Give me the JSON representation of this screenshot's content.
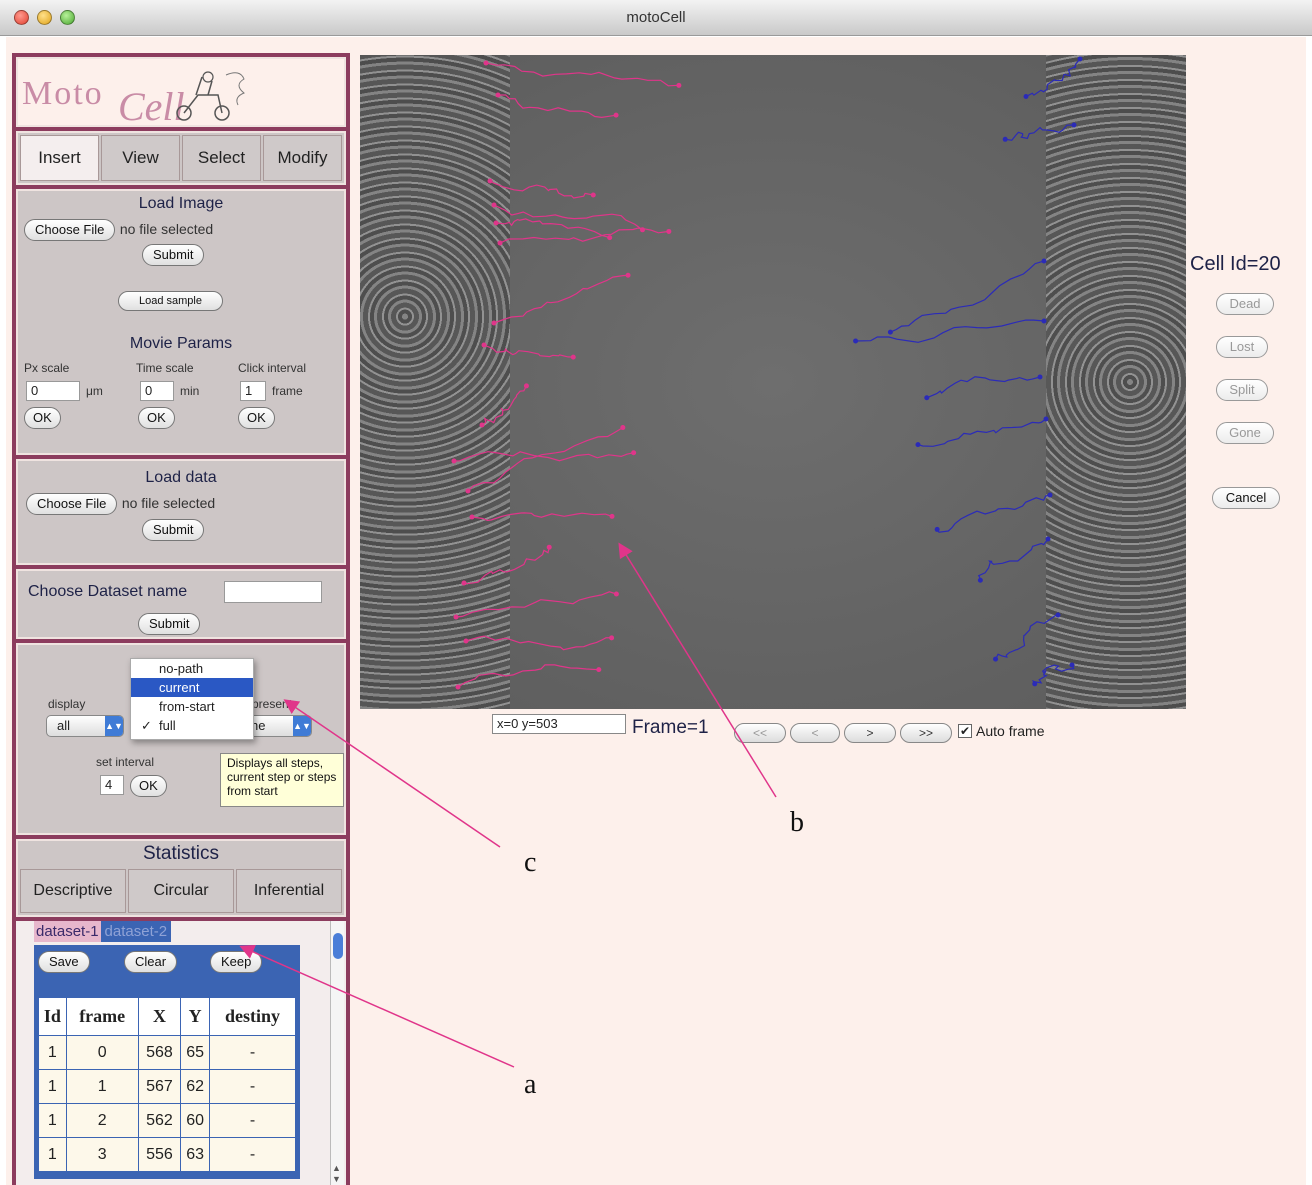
{
  "window": {
    "title": "motoCell"
  },
  "logo": {
    "text_a": "Moto",
    "text_b": "Cell"
  },
  "tabs": [
    "Insert",
    "View",
    "Select",
    "Modify"
  ],
  "load_image": {
    "title": "Load Image",
    "choose_file": "Choose File",
    "no_file": "no file selected",
    "submit": "Submit",
    "load_sample": "Load sample"
  },
  "movie_params": {
    "title": "Movie Params",
    "px_scale": {
      "label": "Px scale",
      "value": "0",
      "unit": "μm",
      "ok": "OK"
    },
    "time_scale": {
      "label": "Time scale",
      "value": "0",
      "unit": "min",
      "ok": "OK"
    },
    "click_interval": {
      "label": "Click interval",
      "value": "1",
      "unit": "frame",
      "ok": "OK"
    }
  },
  "load_data": {
    "title": "Load data",
    "choose_file": "Choose File",
    "no_file": "no file selected",
    "submit": "Submit"
  },
  "dataset_name": {
    "label": "Choose Dataset name",
    "value": "",
    "submit": "Submit"
  },
  "display": {
    "label": "display",
    "select_value": "all",
    "present_label": "present",
    "present_value": "ne",
    "options": [
      "no-path",
      "current",
      "from-start",
      "full"
    ],
    "highlighted": "current",
    "checked": "full",
    "set_interval_label": "set interval",
    "set_interval_value": "4",
    "ok": "OK",
    "tooltip": "Displays all steps, current step or steps from start"
  },
  "statistics": {
    "title": "Statistics",
    "tabs": [
      "Descriptive",
      "Circular",
      "Inferential"
    ]
  },
  "datasets": {
    "tabs": [
      "dataset-1",
      "dataset-2"
    ],
    "buttons": {
      "save": "Save",
      "clear": "Clear",
      "keep": "Keep"
    },
    "columns": [
      "Id",
      "frame",
      "X",
      "Y",
      "destiny"
    ],
    "rows": [
      [
        "1",
        "0",
        "568",
        "65",
        "-"
      ],
      [
        "1",
        "1",
        "567",
        "62",
        "-"
      ],
      [
        "1",
        "2",
        "562",
        "60",
        "-"
      ],
      [
        "1",
        "3",
        "556",
        "63",
        "-"
      ]
    ]
  },
  "viewer": {
    "coords": "x=0 y=503",
    "frame_label": "Frame=1",
    "nav": [
      "<<",
      "<",
      ">",
      ">>"
    ],
    "auto_frame": "Auto frame",
    "auto_frame_checked": true
  },
  "cell_panel": {
    "cell_id": "Cell Id=20",
    "buttons": [
      "Dead",
      "Lost",
      "Split",
      "Gone"
    ],
    "cancel": "Cancel"
  },
  "annotations": {
    "a": "a",
    "b": "b",
    "c": "c"
  },
  "colors": {
    "left_tracks": "#e0358a",
    "right_tracks": "#2b2bb8",
    "arrows": "#e0358a",
    "sidebar_border": "#8c3c5e"
  }
}
